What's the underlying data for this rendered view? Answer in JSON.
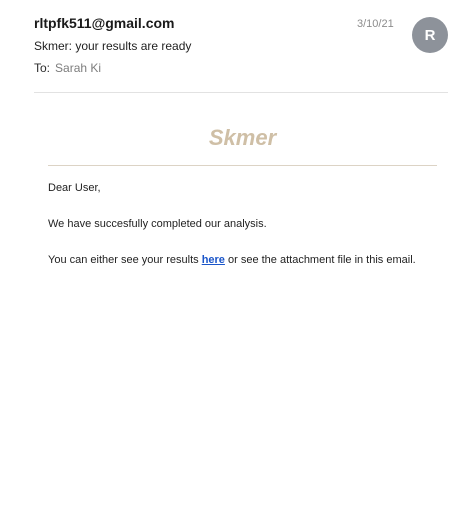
{
  "email": {
    "sender": "rltpfk511@gmail.com",
    "date": "3/10/21",
    "avatar_initial": "R",
    "subject": "Skmer: your results are ready",
    "to_label": "To:",
    "to_value": "Sarah Ki"
  },
  "body": {
    "brand": "Skmer",
    "greeting": "Dear User,",
    "paragraph1": "We have succesfully completed our analysis.",
    "paragraph2_before": "You can either see your results ",
    "link_text": "here",
    "paragraph2_after": " or see the attachment file in this email."
  },
  "colors": {
    "brand": "#cfbfa6",
    "link": "#1a55c9",
    "avatar": "#8d929a"
  }
}
